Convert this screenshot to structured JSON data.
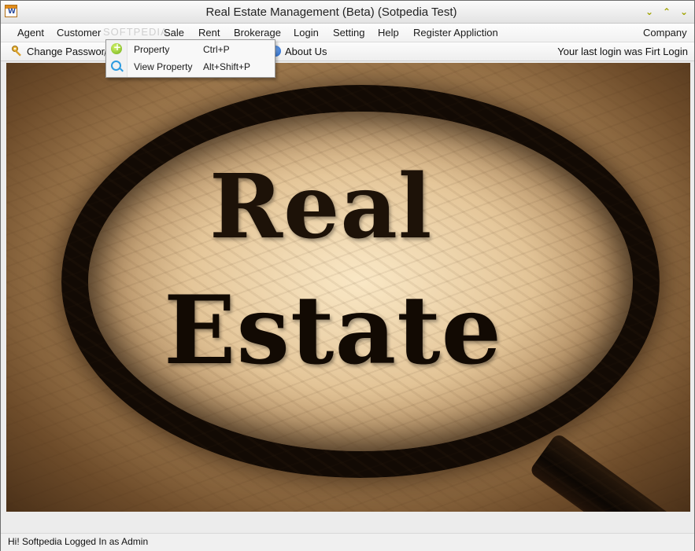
{
  "window": {
    "title": "Real Estate Management (Beta) (Sotpedia Test)",
    "icon": "app-icon",
    "controls": [
      "minimize-icon",
      "maximize-icon",
      "close-icon"
    ]
  },
  "menubar": {
    "items": [
      {
        "label": "Agent"
      },
      {
        "label": "Customer"
      },
      {
        "label": "Sale"
      },
      {
        "label": "Rent"
      },
      {
        "label": "Brokerage"
      },
      {
        "label": "Login"
      },
      {
        "label": "Setting"
      },
      {
        "label": "Help"
      },
      {
        "label": "Register Appliction"
      }
    ],
    "right_item": "Company",
    "watermark": "SOFTPEDIA"
  },
  "toolbar": {
    "change_password": "Change Password",
    "about_us": "About Us",
    "login_status": "Your last login was Firt Login"
  },
  "dropdown": {
    "items": [
      {
        "label": "Property",
        "shortcut": "Ctrl+P",
        "icon": "add-icon"
      },
      {
        "label": "View Property",
        "shortcut": "Alt+Shift+P",
        "icon": "search-icon"
      }
    ]
  },
  "hero": {
    "line1": "Real",
    "line2": "Estate"
  },
  "statusbar": {
    "text": "Hi! Softpedia  Logged In as Admin"
  }
}
